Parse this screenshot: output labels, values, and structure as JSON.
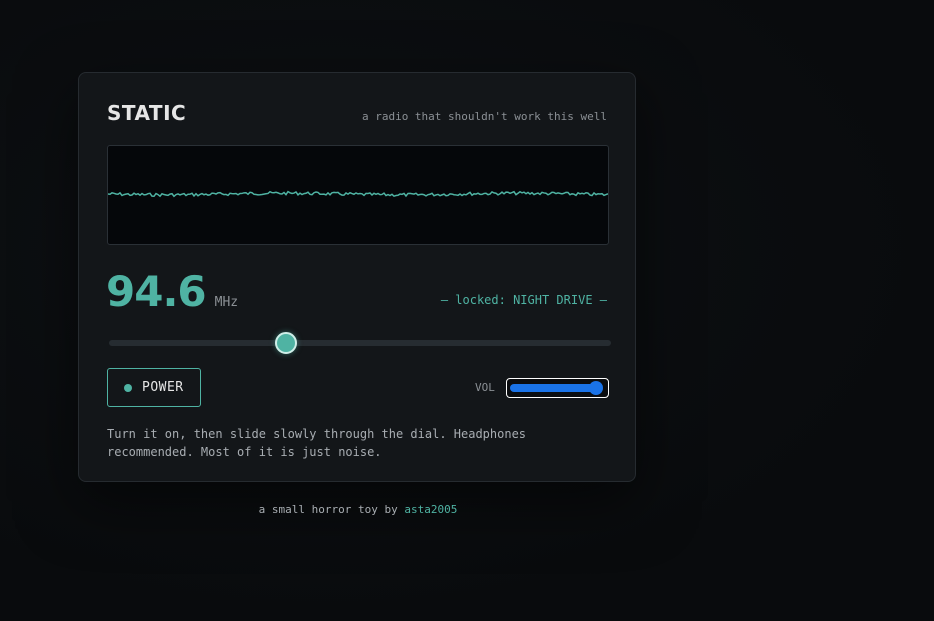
{
  "app": {
    "title": "STATIC",
    "tagline": "a radio that shouldn't work this well"
  },
  "scope": {
    "trace_color": "#4fb3a3",
    "background_color": "#05070a"
  },
  "tuner": {
    "frequency": "94.6",
    "unit": "MHz",
    "lock_status": "— locked: NIGHT DRIVE —",
    "dial_position": 0.35
  },
  "controls": {
    "power_label": "POWER",
    "power_on": true,
    "volume_label": "VOL",
    "volume_level": 0.95
  },
  "help_text": "Turn it on, then slide slowly through the dial. Headphones recommended. Most of it is just noise.",
  "footer": {
    "text": "a small horror toy by",
    "author": "asta2005"
  },
  "colors": {
    "accent": "#4fb3a3",
    "volume_accent": "#1a73e8",
    "card_background": "#131619",
    "page_background": "#0a0c0e"
  }
}
